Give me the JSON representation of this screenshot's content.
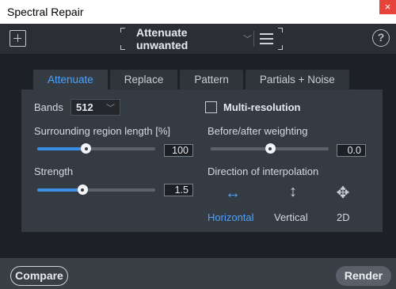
{
  "window": {
    "title": "Spectral Repair",
    "close_glyph": "×"
  },
  "header": {
    "add_icon": "add-module-icon",
    "preset_label": "Attenuate unwanted",
    "preset_chevron": "chevron-down-icon",
    "menu_icon": "hamburger-menu-icon",
    "help_glyph": "?"
  },
  "tabs": [
    {
      "label": "Attenuate",
      "active": true
    },
    {
      "label": "Replace",
      "active": false
    },
    {
      "label": "Pattern",
      "active": false
    },
    {
      "label": "Partials + Noise",
      "active": false
    }
  ],
  "left": {
    "bands_label": "Bands",
    "bands_value": "512",
    "surrounding_label": "Surrounding region length [%]",
    "surrounding_value": "100",
    "surrounding_fraction": 0.41,
    "strength_label": "Strength",
    "strength_value": "1.5",
    "strength_fraction": 0.38
  },
  "right": {
    "multires_label": "Multi-resolution",
    "multires_checked": false,
    "weighting_label": "Before/after weighting",
    "weighting_value": "0.0",
    "weighting_fraction": 0.5,
    "direction_label": "Direction of interpolation",
    "directions": [
      {
        "label": "Horizontal",
        "glyph": "↔",
        "icon": "horizontal-arrows-icon",
        "active": true
      },
      {
        "label": "Vertical",
        "glyph": "↕",
        "icon": "vertical-arrows-icon",
        "active": false
      },
      {
        "label": "2D",
        "glyph": "✥",
        "icon": "four-way-arrows-icon",
        "active": false
      }
    ]
  },
  "footer": {
    "compare_label": "Compare",
    "render_label": "Render"
  },
  "colors": {
    "accent": "#4aa3ff",
    "slider_fill": "#3d8fe6",
    "panel": "#353b43",
    "background": "#1b1e22"
  }
}
